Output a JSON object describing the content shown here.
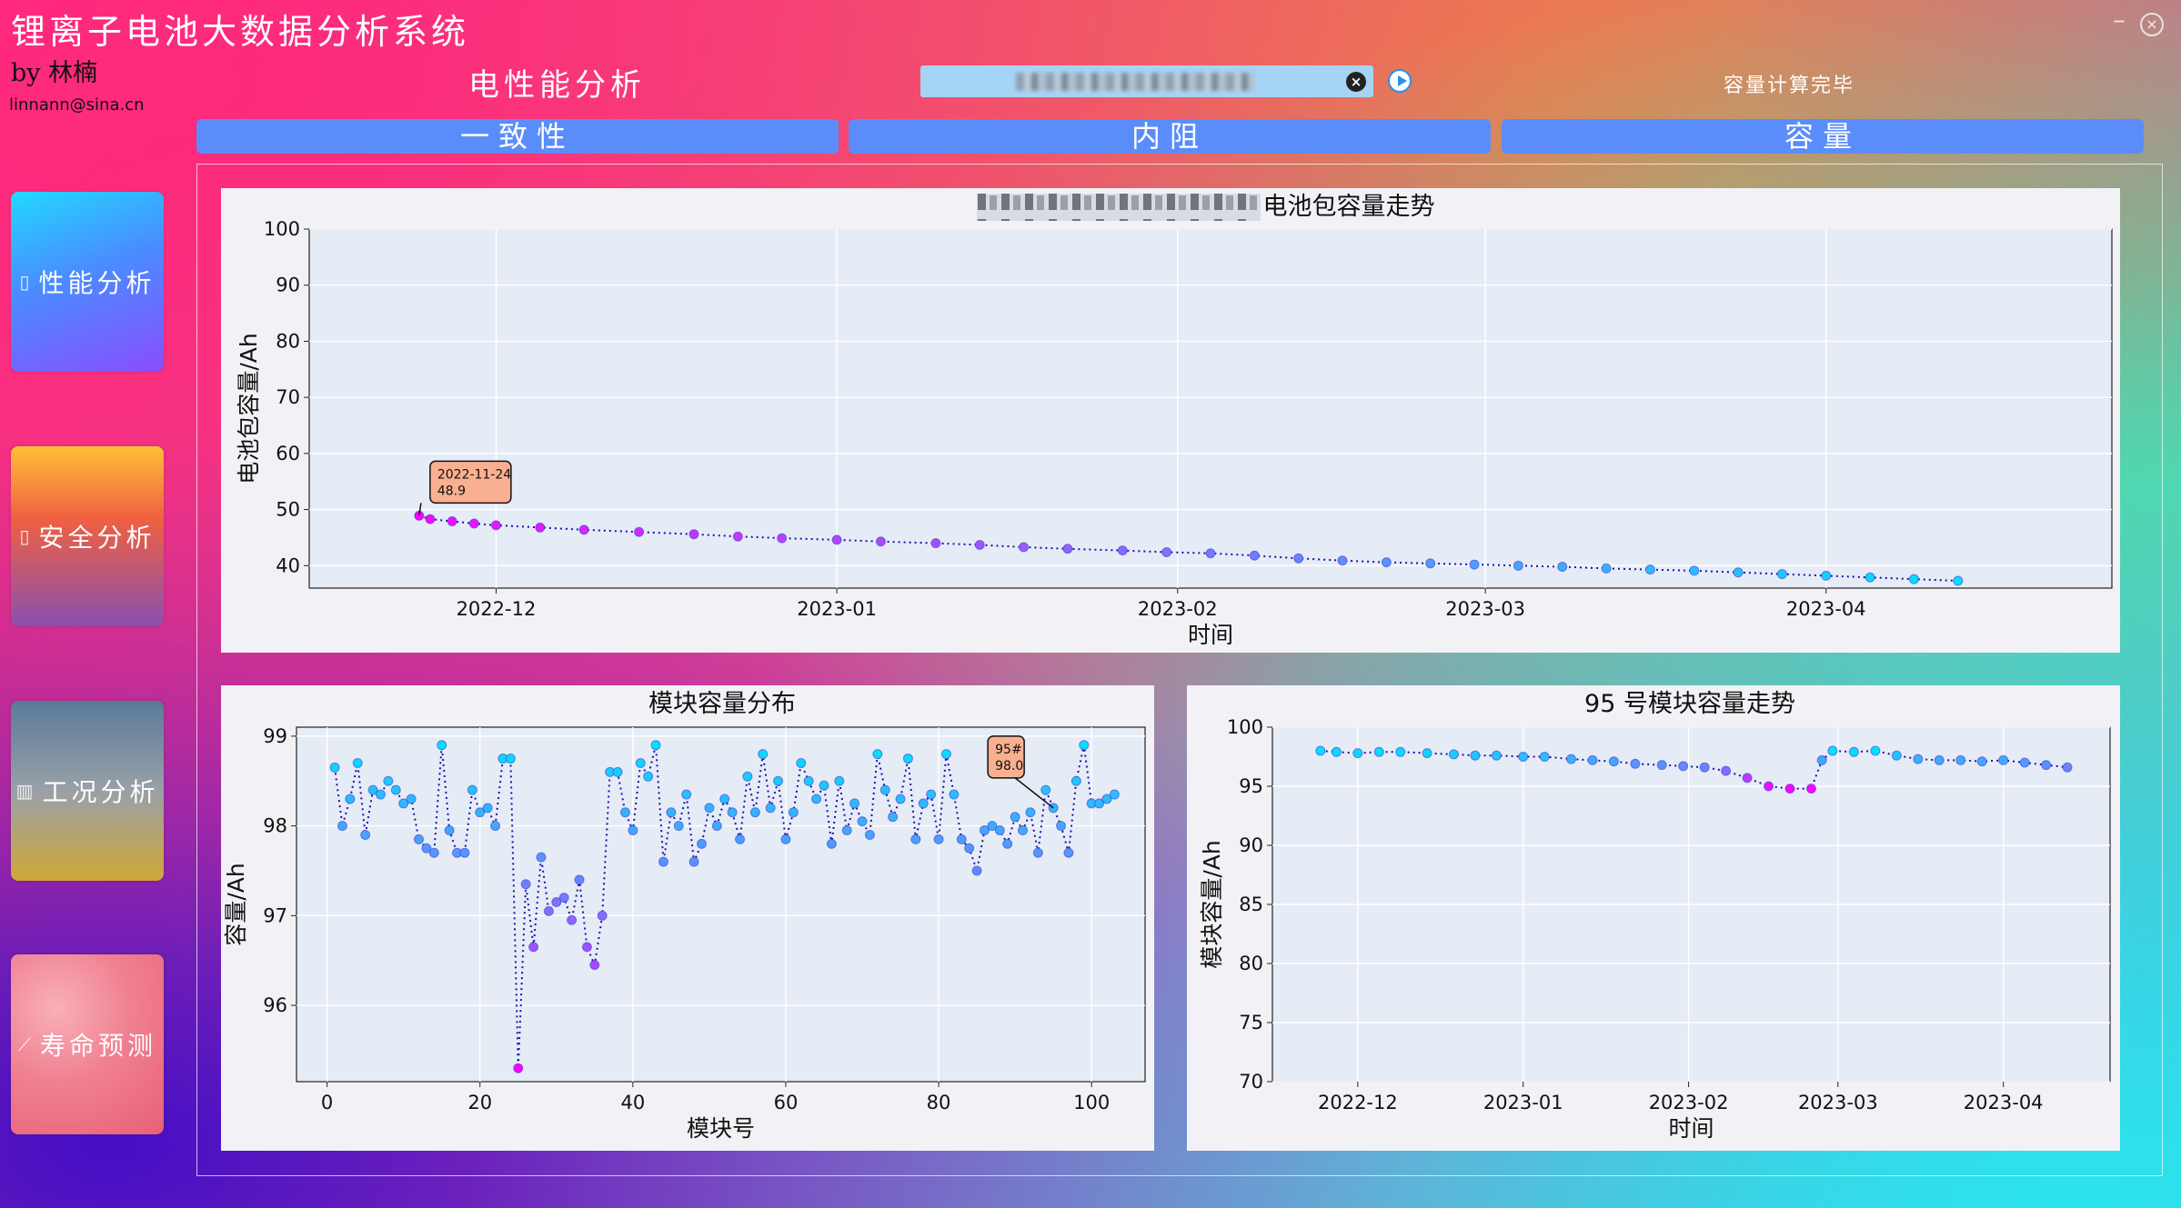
{
  "app": {
    "title": "锂离子电池大数据分析系统",
    "author": "by 林楠",
    "email": "linnann@sina.cn"
  },
  "header": {
    "page_heading": "电性能分析",
    "status": "容量计算完毕"
  },
  "tabs": [
    {
      "label": "一致性"
    },
    {
      "label": "内阻"
    },
    {
      "label": "容量"
    }
  ],
  "sidebar": {
    "items": [
      {
        "label": "性能分析",
        "icon": "battery-icon"
      },
      {
        "label": "安全分析",
        "icon": "battery-outline-icon"
      },
      {
        "label": "工况分析",
        "icon": "bar-chart-icon"
      },
      {
        "label": "寿命预测",
        "icon": "line-chart-icon"
      }
    ]
  },
  "chart_data": [
    {
      "type": "line",
      "title": "电池包容量走势",
      "xlabel": "时间",
      "ylabel": "电池包容量/Ah",
      "ylim": [
        36,
        100
      ],
      "yticks": [
        40,
        50,
        60,
        70,
        80,
        90,
        100
      ],
      "xticks": [
        "2022-12",
        "2023-01",
        "2023-02",
        "2023-03",
        "2023-04"
      ],
      "x": [
        "2022-11-24",
        "2022-11-25",
        "2022-11-27",
        "2022-11-29",
        "2022-12-01",
        "2022-12-05",
        "2022-12-09",
        "2022-12-14",
        "2022-12-19",
        "2022-12-23",
        "2022-12-27",
        "2023-01-01",
        "2023-01-05",
        "2023-01-10",
        "2023-01-14",
        "2023-01-18",
        "2023-01-22",
        "2023-01-27",
        "2023-01-31",
        "2023-02-04",
        "2023-02-08",
        "2023-02-12",
        "2023-02-16",
        "2023-02-20",
        "2023-02-24",
        "2023-02-28",
        "2023-03-04",
        "2023-03-08",
        "2023-03-12",
        "2023-03-16",
        "2023-03-20",
        "2023-03-24",
        "2023-03-28",
        "2023-04-01",
        "2023-04-05",
        "2023-04-09",
        "2023-04-13"
      ],
      "values": [
        48.9,
        48.3,
        47.9,
        47.5,
        47.2,
        46.8,
        46.4,
        46.0,
        45.6,
        45.2,
        44.9,
        44.6,
        44.3,
        44.0,
        43.7,
        43.3,
        43.0,
        42.7,
        42.4,
        42.2,
        41.8,
        41.3,
        40.9,
        40.6,
        40.4,
        40.2,
        40.0,
        39.8,
        39.5,
        39.3,
        39.1,
        38.8,
        38.5,
        38.2,
        37.9,
        37.6,
        37.3
      ],
      "annotation": {
        "x": "2022-11-24",
        "text1": "2022-11-24",
        "text2": "48.9"
      }
    },
    {
      "type": "scatter",
      "title": "模块容量分布",
      "xlabel": "模块号",
      "ylabel": "容量/Ah",
      "xlim": [
        -4,
        107
      ],
      "ylim": [
        95.15,
        99.1
      ],
      "xticks": [
        0,
        20,
        40,
        60,
        80,
        100
      ],
      "yticks": [
        96,
        97,
        98,
        99
      ],
      "values": [
        98.65,
        98.0,
        98.3,
        98.7,
        97.9,
        98.4,
        98.35,
        98.5,
        98.4,
        98.25,
        98.3,
        97.85,
        97.75,
        97.7,
        98.9,
        97.95,
        97.7,
        97.7,
        98.4,
        98.15,
        98.2,
        98.0,
        98.75,
        98.75,
        95.3,
        97.35,
        96.65,
        97.65,
        97.05,
        97.15,
        97.2,
        96.95,
        97.4,
        96.65,
        96.45,
        97.0,
        98.6,
        98.6,
        98.15,
        97.95,
        98.7,
        98.55,
        98.9,
        97.6,
        98.15,
        98.0,
        98.35,
        97.6,
        97.8,
        98.2,
        98.0,
        98.3,
        98.15,
        97.85,
        98.55,
        98.15,
        98.8,
        98.2,
        98.5,
        97.85,
        98.15,
        98.7,
        98.5,
        98.3,
        98.45,
        97.8,
        98.5,
        97.95,
        98.25,
        98.05,
        97.9,
        98.8,
        98.4,
        98.1,
        98.3,
        98.75,
        97.85,
        98.25,
        98.35,
        97.85,
        98.8,
        98.35,
        97.85,
        97.75,
        97.5,
        97.95,
        98.0,
        97.95,
        97.8,
        98.1,
        97.95,
        98.15,
        97.7,
        98.4,
        98.2,
        98.0,
        97.7,
        98.5,
        98.9,
        98.25,
        98.25,
        98.3,
        98.35
      ],
      "annotation": {
        "x": 95,
        "text1": "95#",
        "text2": "98.0"
      }
    },
    {
      "type": "line",
      "title": "95 号模块容量走势",
      "xlabel": "时间",
      "ylabel": "模块容量/Ah",
      "ylim": [
        70,
        100
      ],
      "yticks": [
        70,
        75,
        80,
        85,
        90,
        95,
        100
      ],
      "xticks": [
        "2022-12",
        "2023-01",
        "2023-02",
        "2023-03",
        "2023-04"
      ],
      "x": [
        "2022-11-24",
        "2022-11-27",
        "2022-12-01",
        "2022-12-05",
        "2022-12-09",
        "2022-12-14",
        "2022-12-19",
        "2022-12-23",
        "2022-12-27",
        "2023-01-01",
        "2023-01-05",
        "2023-01-10",
        "2023-01-14",
        "2023-01-18",
        "2023-01-22",
        "2023-01-27",
        "2023-01-31",
        "2023-02-04",
        "2023-02-08",
        "2023-02-12",
        "2023-02-16",
        "2023-02-20",
        "2023-02-24",
        "2023-02-26",
        "2023-02-28",
        "2023-03-04",
        "2023-03-08",
        "2023-03-12",
        "2023-03-16",
        "2023-03-20",
        "2023-03-24",
        "2023-03-28",
        "2023-04-01",
        "2023-04-05",
        "2023-04-09",
        "2023-04-13"
      ],
      "values": [
        98.0,
        97.9,
        97.8,
        97.9,
        97.9,
        97.8,
        97.7,
        97.6,
        97.6,
        97.5,
        97.5,
        97.3,
        97.2,
        97.1,
        96.9,
        96.8,
        96.7,
        96.6,
        96.3,
        95.7,
        95.0,
        94.8,
        94.8,
        97.2,
        98.0,
        97.9,
        98.0,
        97.6,
        97.3,
        97.2,
        97.2,
        97.1,
        97.2,
        97.0,
        96.8,
        96.6
      ]
    }
  ]
}
